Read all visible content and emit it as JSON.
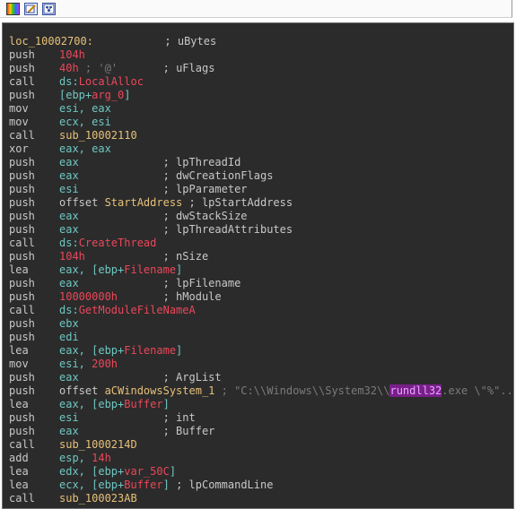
{
  "toolbar": {
    "icons": [
      "color-palette-icon",
      "edit-icon",
      "graph-view-icon"
    ]
  },
  "colors": {
    "background": "#2b2b2b",
    "text": "#c8c8c8",
    "label": "#e6c17a",
    "number": "#e8485a",
    "register": "#6fc7c2",
    "highlight": "#7a1f8a"
  },
  "code": {
    "label": "loc_10002700:",
    "label_comment": "; uBytes",
    "l1_m": "push",
    "l1_a": "104h",
    "l2_m": "push",
    "l2_a": "40h",
    "l2_c1": "; '@'",
    "l2_c2": "; uFlags",
    "l3_m": "call",
    "l3_p": "ds:",
    "l3_f": "LocalAlloc",
    "l4_m": "push",
    "l4_a1": "[ebp+",
    "l4_a2": "arg_0",
    "l4_a3": "]",
    "l5_m": "mov",
    "l5_a": "esi, eax",
    "l6_m": "mov",
    "l6_a": "ecx, esi",
    "l7_m": "call",
    "l7_a": "sub_10002110",
    "l8_m": "xor",
    "l8_a": "eax, eax",
    "l9_m": "push",
    "l9_a": "eax",
    "l9_c": "; lpThreadId",
    "l10_m": "push",
    "l10_a": "eax",
    "l10_c": "; dwCreationFlags",
    "l11_m": "push",
    "l11_a": "esi",
    "l11_c": "; lpParameter",
    "l12_m": "push",
    "l12_a1": "offset ",
    "l12_a2": "StartAddress",
    "l12_c": " ; lpStartAddress",
    "l13_m": "push",
    "l13_a": "eax",
    "l13_c": "; dwStackSize",
    "l14_m": "push",
    "l14_a": "eax",
    "l14_c": "; lpThreadAttributes",
    "l15_m": "call",
    "l15_p": "ds:",
    "l15_f": "CreateThread",
    "l16_m": "push",
    "l16_a": "104h",
    "l16_c": "; nSize",
    "l17_m": "lea",
    "l17_a1": "eax, [ebp+",
    "l17_a2": "Filename",
    "l17_a3": "]",
    "l18_m": "push",
    "l18_a": "eax",
    "l18_c": "; lpFilename",
    "l19_m": "push",
    "l19_a": "10000000h",
    "l19_c": "; hModule",
    "l20_m": "call",
    "l20_p": "ds:",
    "l20_f": "GetModuleFileNameA",
    "l21_m": "push",
    "l21_a": "ebx",
    "l22_m": "push",
    "l22_a": "edi",
    "l23_m": "lea",
    "l23_a1": "eax, [ebp+",
    "l23_a2": "Filename",
    "l23_a3": "]",
    "l24_m": "mov",
    "l24_a1": "esi, ",
    "l24_a2": "200h",
    "l25_m": "push",
    "l25_a": "eax",
    "l25_c": "; ArgList",
    "l26_m": "push",
    "l26_a1": "offset ",
    "l26_a2": "aCWindowsSystem_1",
    "l26_c1": " ; \"C:\\\\Windows\\\\System32\\\\",
    "l26_hl": "rundll32",
    "l26_c2": ".exe \\\"%\"...",
    "l27_m": "lea",
    "l27_a1": "eax, [ebp+",
    "l27_a2": "Buffer",
    "l27_a3": "]",
    "l28_m": "push",
    "l28_a": "esi",
    "l28_c": "; int",
    "l29_m": "push",
    "l29_a": "eax",
    "l29_c": "; Buffer",
    "l30_m": "call",
    "l30_a": "sub_1000214D",
    "l31_m": "add",
    "l31_a1": "esp, ",
    "l31_a2": "14h",
    "l32_m": "lea",
    "l32_a1": "edx, [ebp+",
    "l32_a2": "var_50C",
    "l32_a3": "]",
    "l33_m": "lea",
    "l33_a1": "ecx, [ebp+",
    "l33_a2": "Buffer",
    "l33_a3": "]",
    "l33_c": " ; lpCommandLine",
    "l34_m": "call",
    "l34_a": "sub_100023AB"
  }
}
